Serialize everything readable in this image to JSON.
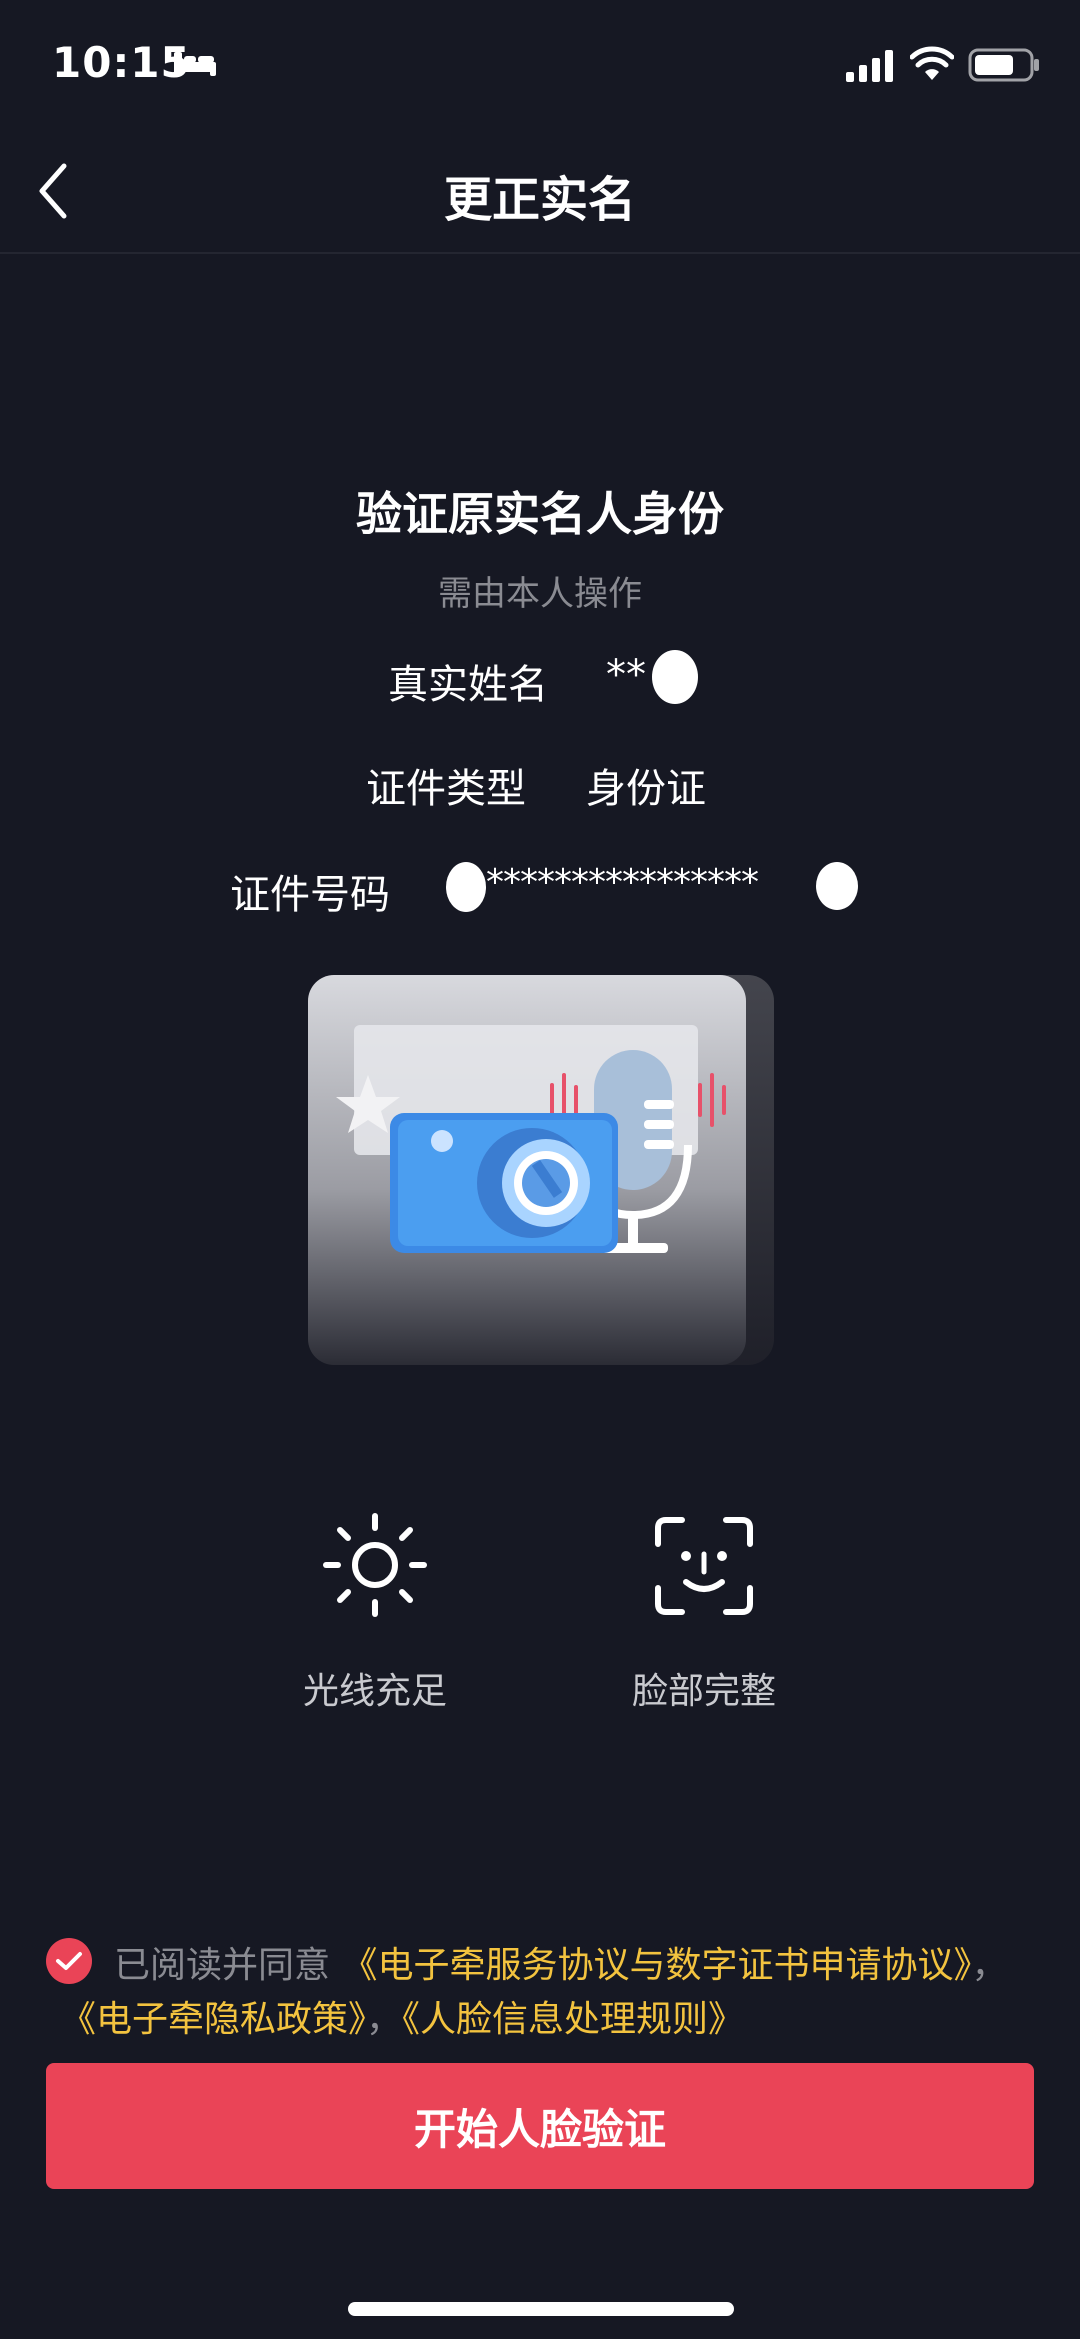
{
  "status_bar": {
    "time": "10:15",
    "icons": [
      "bed-icon",
      "cellular-signal-icon",
      "wifi-icon",
      "battery-icon"
    ]
  },
  "nav": {
    "back_icon": "chevron-left-icon",
    "title": "更正实名"
  },
  "verify": {
    "heading": "验证原实名人身份",
    "subheading": "需由本人操作",
    "name_label": "真实姓名",
    "name_value": "**",
    "id_type_label": "证件类型",
    "id_type_value": "身份证",
    "id_number_label": "证件号码",
    "id_number_value": "****************"
  },
  "illustration": {
    "icons": [
      "camera-icon",
      "microphone-icon",
      "star-icon"
    ]
  },
  "tips": [
    {
      "icon": "sun-icon",
      "label": "光线充足"
    },
    {
      "icon": "face-scan-icon",
      "label": "脸部完整"
    }
  ],
  "agreement": {
    "checked": true,
    "prefix": "已阅读并同意",
    "link_service": "《电子牵服务协议与数字证书申请协议》",
    "separator": "，",
    "link_privacy": "《电子牵隐私政策》",
    "separator2": "，",
    "link_face": "《人脸信息处理规则》"
  },
  "primary_button": {
    "label": "开始人脸验证"
  },
  "colors": {
    "background": "#161823",
    "accent": "#EA4457",
    "link": "#F3C33F",
    "muted_text": "#8A8B92"
  }
}
